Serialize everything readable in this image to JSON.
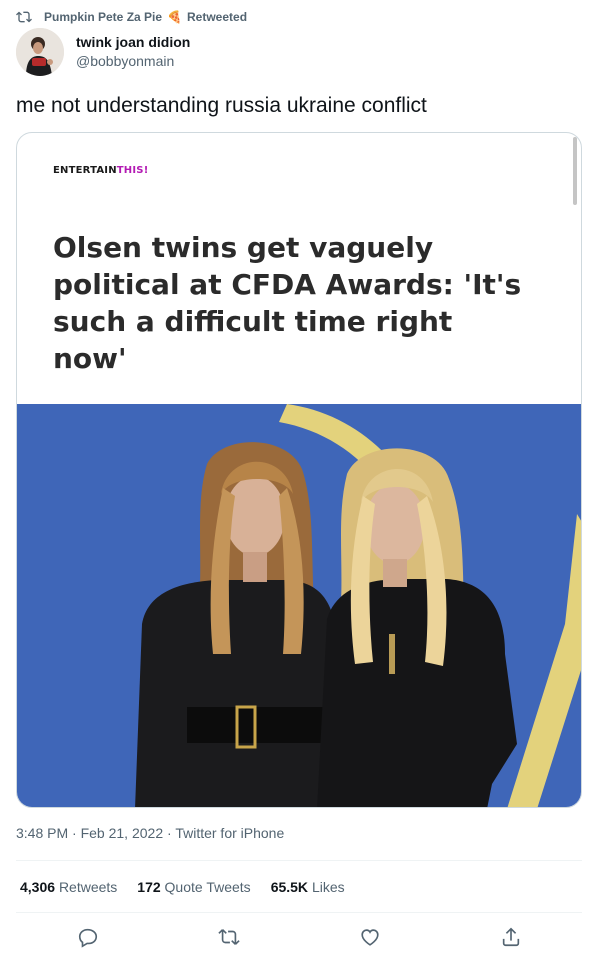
{
  "retweet": {
    "retweeter_name": "Pumpkin Pete Za Pie",
    "emoji": "🍕",
    "label": "Retweeted"
  },
  "author": {
    "display_name": "twink joan didion",
    "handle": "@bobbyonmain"
  },
  "tweet": {
    "text": "me not understanding russia ukraine conflict"
  },
  "card": {
    "brand_part1": "ENTERTAIN",
    "brand_part2": "THIS!",
    "headline": "Olsen twins get vaguely political at CFDA Awards: 'It's such a difficult time right now'"
  },
  "meta": {
    "time": "3:48 PM",
    "separator": "·",
    "date": "Feb 21, 2022",
    "source": "Twitter for iPhone"
  },
  "stats": {
    "retweets_count": "4,306",
    "retweets_label": "Retweets",
    "quotes_count": "172",
    "quotes_label": "Quote Tweets",
    "likes_count": "65.5K",
    "likes_label": "Likes"
  },
  "icons": {
    "retweet": "retweet-icon",
    "reply": "reply-icon",
    "like": "like-icon",
    "share": "share-icon"
  }
}
